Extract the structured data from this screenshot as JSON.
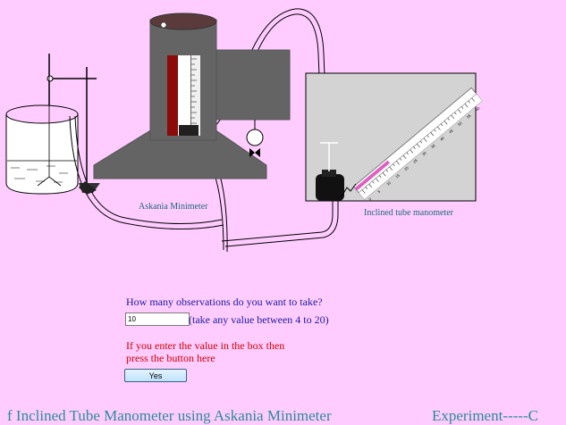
{
  "captions": {
    "askania": "Askania Minimeter",
    "inclined": "Inclined tube manometer"
  },
  "scale_labels": [
    "0",
    "5",
    "10",
    "15",
    "20",
    "25",
    "30",
    "35",
    "40",
    "45",
    "50",
    "55",
    "60"
  ],
  "form": {
    "question": "How many observations do you want to take?",
    "input_value": "10",
    "hint": "(take any value between 4 to 20)",
    "instruction_line1": "If you enter the value in the box then",
    "instruction_line2": "press the button here",
    "button_label": "Yes"
  },
  "marquee": {
    "segment1": "f Inclined Tube Manometer using Askania Minimeter",
    "segment2": "Experiment-----C"
  },
  "colors": {
    "background": "#ffccff",
    "instrument_gray": "#646464",
    "instruction_red": "#d40000",
    "question_blue": "#1a1aa0",
    "caption_teal": "#1d6a78"
  }
}
